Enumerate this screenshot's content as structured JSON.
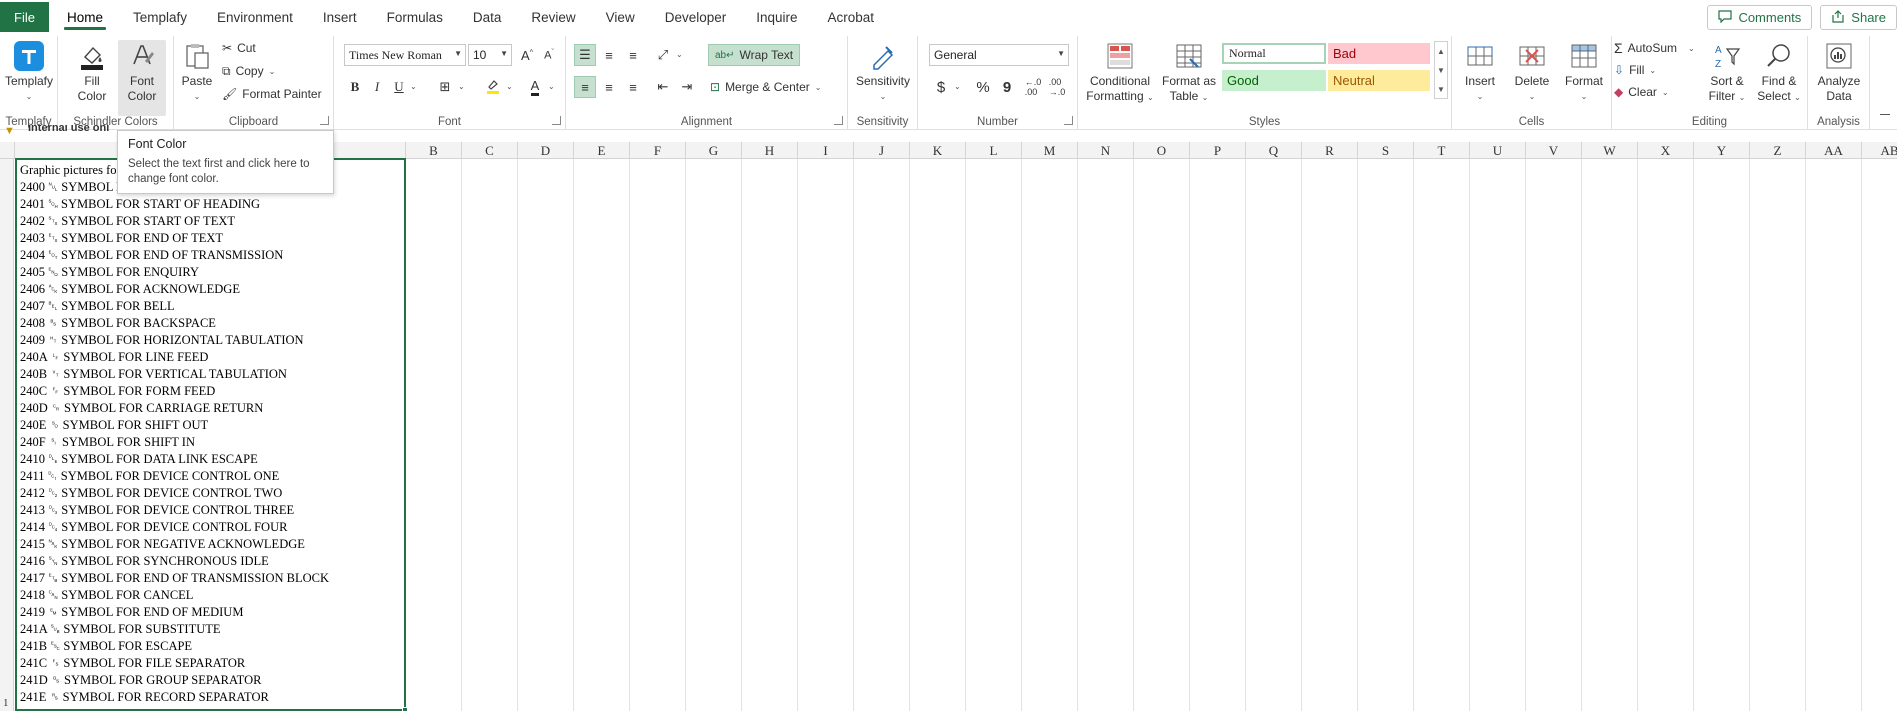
{
  "tabs": {
    "file": "File",
    "items": [
      "Home",
      "Templafy",
      "Environment",
      "Insert",
      "Formulas",
      "Data",
      "Review",
      "View",
      "Developer",
      "Inquire",
      "Acrobat"
    ],
    "active": "Home",
    "comments": "Comments",
    "share": "Share"
  },
  "ribbon": {
    "templafy": {
      "button": "Templafy",
      "group": "Templafy"
    },
    "schindler": {
      "fill_1": "Fill",
      "fill_2": "Color",
      "font_1": "Font",
      "font_2": "Color",
      "group": "Schindler Colors"
    },
    "clipboard": {
      "paste": "Paste",
      "cut": "Cut",
      "copy": "Copy",
      "format_painter": "Format Painter",
      "group": "Clipboard"
    },
    "font": {
      "name": "Times New Roman",
      "size": "10",
      "bold": "B",
      "italic": "I",
      "underline": "U",
      "group": "Font"
    },
    "alignment": {
      "wrap": "Wrap Text",
      "merge": "Merge & Center",
      "group": "Alignment"
    },
    "sensitivity": {
      "button": "Sensitivity",
      "group": "Sensitivity"
    },
    "number": {
      "format": "General",
      "currency": "$",
      "percent": "%",
      "comma": "9",
      "group": "Number"
    },
    "styles": {
      "conditional_1": "Conditional",
      "conditional_2": "Formatting",
      "table_1": "Format as",
      "table_2": "Table",
      "normal": "Normal",
      "bad": "Bad",
      "good": "Good",
      "neutral": "Neutral",
      "group": "Styles"
    },
    "cells": {
      "insert": "Insert",
      "delete": "Delete",
      "format": "Format",
      "group": "Cells"
    },
    "editing": {
      "autosum": "AutoSum",
      "fill": "Fill",
      "clear": "Clear",
      "sort_1": "Sort &",
      "sort_2": "Filter",
      "find_1": "Find &",
      "find_2": "Select",
      "group": "Editing"
    },
    "analysis": {
      "analyze_1": "Analyze",
      "analyze_2": "Data",
      "group": "Analysis"
    }
  },
  "tooltip": {
    "title": "Font Color",
    "body": "Select the text first and click here to change font color."
  },
  "notice": "Internal use onl",
  "sheet": {
    "columns": [
      "B",
      "C",
      "D",
      "E",
      "F",
      "G",
      "H",
      "I",
      "J",
      "K",
      "L",
      "M",
      "N",
      "O",
      "P",
      "Q",
      "R",
      "S",
      "T",
      "U",
      "V",
      "W",
      "X",
      "Y",
      "Z",
      "AA",
      "AB"
    ],
    "row_number": "1",
    "cell_lines": [
      "Graphic pictures fo",
      "2400 ␀ SYMBOL F",
      "2401 ␁ SYMBOL FOR START OF HEADING",
      "2402 ␂ SYMBOL FOR START OF TEXT",
      "2403 ␃ SYMBOL FOR END OF TEXT",
      "2404 ␄ SYMBOL FOR END OF TRANSMISSION",
      "2405 ␅ SYMBOL FOR ENQUIRY",
      "2406 ␆ SYMBOL FOR ACKNOWLEDGE",
      "2407 ␇ SYMBOL FOR BELL",
      "2408 ␈ SYMBOL FOR BACKSPACE",
      "2409 ␉ SYMBOL FOR HORIZONTAL TABULATION",
      "240A ␊ SYMBOL FOR LINE FEED",
      "240B ␋ SYMBOL FOR VERTICAL TABULATION",
      "240C ␌ SYMBOL FOR FORM FEED",
      "240D ␍ SYMBOL FOR CARRIAGE RETURN",
      "240E ␎ SYMBOL FOR SHIFT OUT",
      "240F ␏ SYMBOL FOR SHIFT IN",
      "2410 ␐ SYMBOL FOR DATA LINK ESCAPE",
      "2411 ␑ SYMBOL FOR DEVICE CONTROL ONE",
      "2412 ␒ SYMBOL FOR DEVICE CONTROL TWO",
      "2413 ␓ SYMBOL FOR DEVICE CONTROL THREE",
      "2414 ␔ SYMBOL FOR DEVICE CONTROL FOUR",
      "2415 ␕ SYMBOL FOR NEGATIVE ACKNOWLEDGE",
      "2416 ␖ SYMBOL FOR SYNCHRONOUS IDLE",
      "2417 ␗ SYMBOL FOR END OF TRANSMISSION BLOCK",
      "2418 ␘ SYMBOL FOR CANCEL",
      "2419 ␙ SYMBOL FOR END OF MEDIUM",
      "241A ␚ SYMBOL FOR SUBSTITUTE",
      "241B ␛ SYMBOL FOR ESCAPE",
      "241C ␜ SYMBOL FOR FILE SEPARATOR",
      "241D ␝ SYMBOL FOR GROUP SEPARATOR",
      "241E ␞ SYMBOL FOR RECORD SEPARATOR"
    ]
  },
  "colors": {
    "accent": "#217346",
    "style_normal_bg": "#ffffff",
    "style_bad_bg": "#ffc7ce",
    "style_bad_fg": "#9c0006",
    "style_good_bg": "#c6efce",
    "style_good_fg": "#006100",
    "style_neutral_bg": "#ffeb9c",
    "style_neutral_fg": "#9c5700"
  },
  "icons": [
    "templafy-logo-icon",
    "fill-color-icon",
    "font-color-icon",
    "paste-icon",
    "cut-icon",
    "copy-icon",
    "format-painter-icon",
    "sensitivity-icon",
    "conditional-formatting-icon",
    "format-table-icon",
    "insert-cells-icon",
    "delete-cells-icon",
    "format-cells-icon",
    "autosum-icon",
    "fill-down-icon",
    "clear-icon",
    "sort-filter-icon",
    "find-select-icon",
    "analyze-data-icon",
    "comment-icon",
    "share-icon",
    "warning-icon"
  ]
}
